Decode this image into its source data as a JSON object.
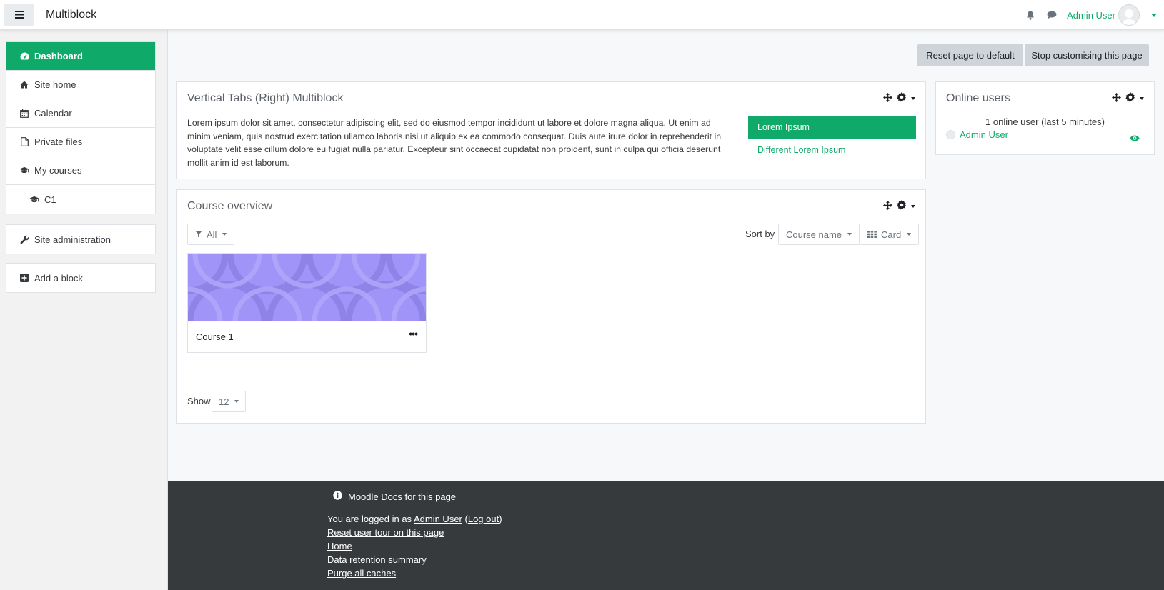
{
  "navbar": {
    "site_name": "Multiblock",
    "user_name": "Admin User"
  },
  "drawer": {
    "items": [
      {
        "label": "Dashboard",
        "icon": "dashboard-icon",
        "active": true
      },
      {
        "label": "Site home",
        "icon": "home-icon"
      },
      {
        "label": "Calendar",
        "icon": "calendar-icon"
      },
      {
        "label": "Private files",
        "icon": "file-icon"
      },
      {
        "label": "My courses",
        "icon": "graduation-cap-icon"
      },
      {
        "label": "C1",
        "icon": "graduation-cap-icon"
      }
    ],
    "admin": {
      "label": "Site administration",
      "icon": "wrench-icon"
    },
    "add_block": {
      "label": "Add a block",
      "icon": "plus-square-icon"
    }
  },
  "toolbar": {
    "reset_label": "Reset page to default",
    "stop_label": "Stop customising this page"
  },
  "multiblock": {
    "title": "Vertical Tabs (Right) Multiblock",
    "body": "Lorem ipsum dolor sit amet, consectetur adipiscing elit, sed do eiusmod tempor incididunt ut labore et dolore magna aliqua. Ut enim ad minim veniam, quis nostrud exercitation ullamco laboris nisi ut aliquip ex ea commodo consequat. Duis aute irure dolor in reprehenderit in voluptate velit esse cillum dolore eu fugiat nulla pariatur. Excepteur sint occaecat cupidatat non proident, sunt in culpa qui officia deserunt mollit anim id est laborum.",
    "tabs": [
      "Lorem Ipsum",
      "Different Lorem Ipsum"
    ]
  },
  "course_overview": {
    "title": "Course overview",
    "filter_label": "All",
    "sort_label": "Sort by",
    "sort_value": "Course name",
    "view_value": "Card",
    "courses": [
      {
        "name": "Course 1"
      }
    ],
    "show_label": "Show",
    "show_value": "12"
  },
  "online_users": {
    "title": "Online users",
    "summary": "1 online user (last 5 minutes)",
    "users": [
      "Admin User"
    ]
  },
  "footer": {
    "docs_link": "Moodle Docs for this page",
    "logged_in_prefix": "You are logged in as ",
    "logged_in_user": "Admin User",
    "logout_open": " (",
    "logout_label": "Log out",
    "logout_close": ")",
    "links": [
      "Reset user tour on this page",
      "Home",
      "Data retention summary",
      "Purge all caches"
    ]
  },
  "colors": {
    "brand": "#0faa6a",
    "footer_bg": "#373a3c",
    "course_image": "#a094f8"
  }
}
